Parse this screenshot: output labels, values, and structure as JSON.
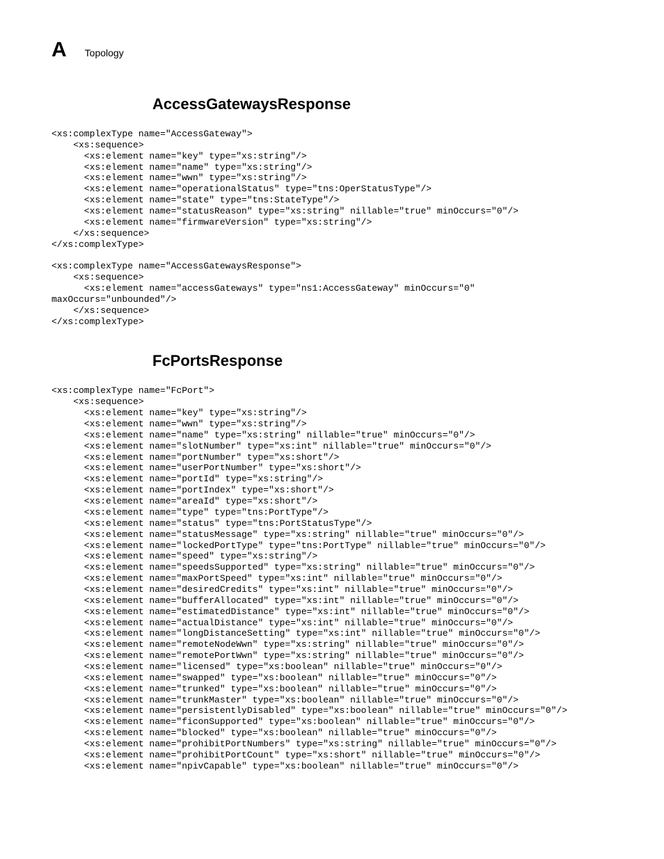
{
  "header": {
    "letter": "A",
    "topic": "Topology"
  },
  "sections": {
    "access": {
      "heading": "AccessGatewaysResponse",
      "code": "<xs:complexType name=\"AccessGateway\">\n    <xs:sequence>\n      <xs:element name=\"key\" type=\"xs:string\"/>\n      <xs:element name=\"name\" type=\"xs:string\"/>\n      <xs:element name=\"wwn\" type=\"xs:string\"/>\n      <xs:element name=\"operationalStatus\" type=\"tns:OperStatusType\"/>\n      <xs:element name=\"state\" type=\"tns:StateType\"/>\n      <xs:element name=\"statusReason\" type=\"xs:string\" nillable=\"true\" minOccurs=\"0\"/>\n      <xs:element name=\"firmwareVersion\" type=\"xs:string\"/>\n    </xs:sequence>\n</xs:complexType>\n\n<xs:complexType name=\"AccessGatewaysResponse\">\n    <xs:sequence>\n      <xs:element name=\"accessGateways\" type=\"ns1:AccessGateway\" minOccurs=\"0\" \nmaxOccurs=\"unbounded\"/>\n    </xs:sequence>\n</xs:complexType>"
    },
    "fcports": {
      "heading": "FcPortsResponse",
      "code": "<xs:complexType name=\"FcPort\">\n    <xs:sequence>\n      <xs:element name=\"key\" type=\"xs:string\"/>\n      <xs:element name=\"wwn\" type=\"xs:string\"/>\n      <xs:element name=\"name\" type=\"xs:string\" nillable=\"true\" minOccurs=\"0\"/>\n      <xs:element name=\"slotNumber\" type=\"xs:int\" nillable=\"true\" minOccurs=\"0\"/>\n      <xs:element name=\"portNumber\" type=\"xs:short\"/>\n      <xs:element name=\"userPortNumber\" type=\"xs:short\"/>\n      <xs:element name=\"portId\" type=\"xs:string\"/>\n      <xs:element name=\"portIndex\" type=\"xs:short\"/>\n      <xs:element name=\"areaId\" type=\"xs:short\"/>\n      <xs:element name=\"type\" type=\"tns:PortType\"/>\n      <xs:element name=\"status\" type=\"tns:PortStatusType\"/>\n      <xs:element name=\"statusMessage\" type=\"xs:string\" nillable=\"true\" minOccurs=\"0\"/>\n      <xs:element name=\"lockedPortType\" type=\"tns:PortType\" nillable=\"true\" minOccurs=\"0\"/>\n      <xs:element name=\"speed\" type=\"xs:string\"/>\n      <xs:element name=\"speedsSupported\" type=\"xs:string\" nillable=\"true\" minOccurs=\"0\"/>\n      <xs:element name=\"maxPortSpeed\" type=\"xs:int\" nillable=\"true\" minOccurs=\"0\"/>\n      <xs:element name=\"desiredCredits\" type=\"xs:int\" nillable=\"true\" minOccurs=\"0\"/>\n      <xs:element name=\"bufferAllocated\" type=\"xs:int\" nillable=\"true\" minOccurs=\"0\"/>\n      <xs:element name=\"estimatedDistance\" type=\"xs:int\" nillable=\"true\" minOccurs=\"0\"/>\n      <xs:element name=\"actualDistance\" type=\"xs:int\" nillable=\"true\" minOccurs=\"0\"/>\n      <xs:element name=\"longDistanceSetting\" type=\"xs:int\" nillable=\"true\" minOccurs=\"0\"/>\n      <xs:element name=\"remoteNodeWwn\" type=\"xs:string\" nillable=\"true\" minOccurs=\"0\"/>\n      <xs:element name=\"remotePortWwn\" type=\"xs:string\" nillable=\"true\" minOccurs=\"0\"/>\n      <xs:element name=\"licensed\" type=\"xs:boolean\" nillable=\"true\" minOccurs=\"0\"/>\n      <xs:element name=\"swapped\" type=\"xs:boolean\" nillable=\"true\" minOccurs=\"0\"/>\n      <xs:element name=\"trunked\" type=\"xs:boolean\" nillable=\"true\" minOccurs=\"0\"/>\n      <xs:element name=\"trunkMaster\" type=\"xs:boolean\" nillable=\"true\" minOccurs=\"0\"/>\n      <xs:element name=\"persistentlyDisabled\" type=\"xs:boolean\" nillable=\"true\" minOccurs=\"0\"/>\n      <xs:element name=\"ficonSupported\" type=\"xs:boolean\" nillable=\"true\" minOccurs=\"0\"/>\n      <xs:element name=\"blocked\" type=\"xs:boolean\" nillable=\"true\" minOccurs=\"0\"/>\n      <xs:element name=\"prohibitPortNumbers\" type=\"xs:string\" nillable=\"true\" minOccurs=\"0\"/>\n      <xs:element name=\"prohibitPortCount\" type=\"xs:short\" nillable=\"true\" minOccurs=\"0\"/>\n      <xs:element name=\"npivCapable\" type=\"xs:boolean\" nillable=\"true\" minOccurs=\"0\"/>"
    }
  }
}
